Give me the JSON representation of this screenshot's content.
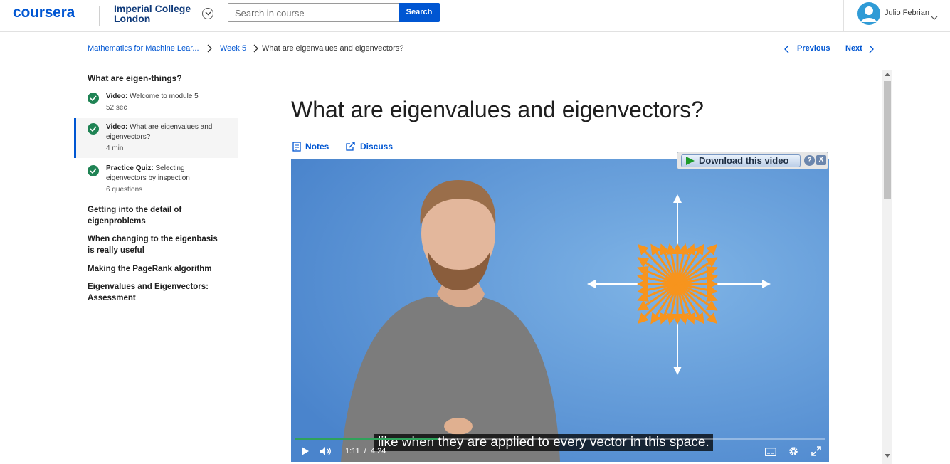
{
  "header": {
    "logo": "coursera",
    "partner_line1": "Imperial College",
    "partner_line2": "London",
    "search_placeholder": "Search in course",
    "search_button": "Search",
    "user_name": "Julio Febrian"
  },
  "breadcrumb": {
    "course": "Mathematics for Machine Lear...",
    "week": "Week 5",
    "current": "What are eigenvalues and eigenvectors?",
    "previous_label": "Previous",
    "next_label": "Next"
  },
  "sidebar": {
    "section_title": "What are eigen-things?",
    "items": [
      {
        "type": "Video:",
        "title": "Welcome to module 5",
        "meta": "52 sec"
      },
      {
        "type": "Video:",
        "title": "What are eigenvalues and eigenvectors?",
        "meta": "4 min"
      },
      {
        "type": "Practice Quiz:",
        "title": "Selecting eigenvectors by inspection",
        "meta": "6 questions"
      }
    ],
    "lessons": [
      "Getting into the detail of eigenproblems",
      "When changing to the eigenbasis is really useful",
      "Making the PageRank algorithm",
      "Eigenvalues and Eigenvectors: Assessment"
    ]
  },
  "main": {
    "title": "What are eigenvalues and eigenvectors?",
    "notes_label": "Notes",
    "discuss_label": "Discuss"
  },
  "video": {
    "caption": "like when they are applied to every vector in this space.",
    "current_time": "1:11",
    "separator": "/",
    "duration": "4:24",
    "progress": 0.27,
    "download_label": "Download this video",
    "help_label": "?",
    "close_label": "X"
  },
  "colors": {
    "brand": "#0056d2",
    "complete": "#1f8354",
    "video_bg": "#4c87cf",
    "arrows": "#f7941d"
  }
}
